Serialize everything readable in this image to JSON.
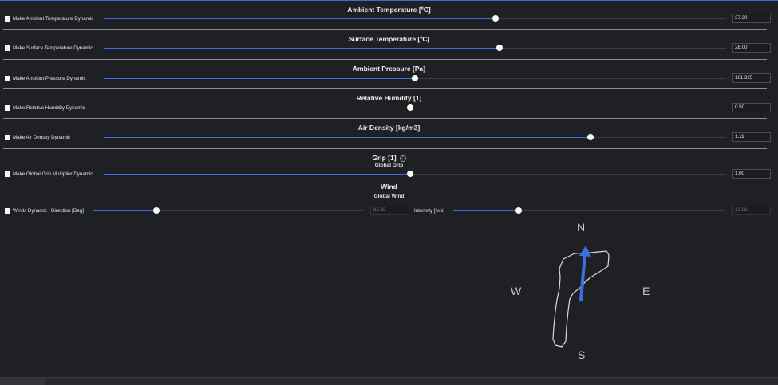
{
  "sections": {
    "ambient_temp": {
      "title": "Ambient Temperature [ºC]",
      "checkbox_label": "Make Ambient Temperature Dynamic",
      "value": "27.20",
      "slider_fraction": 0.63
    },
    "surface_temp": {
      "title": "Surface Temperature [ºC]",
      "checkbox_label": "Make Surface Temperature Dynamic",
      "value": "28.00",
      "slider_fraction": 0.636
    },
    "ambient_pressure": {
      "title": "Ambient Pressure [Pa]",
      "checkbox_label": "Make Ambient Pressure Dynamic",
      "value": "101,325",
      "slider_fraction": 0.5
    },
    "humidity": {
      "title": "Relative Humdity [1]",
      "checkbox_label": "Make Relative Humidity Dynamic",
      "value": "0.50",
      "slider_fraction": 0.492
    },
    "air_density": {
      "title": "Air Density [kg/m3]",
      "checkbox_label": "Make Air Density Dynamic",
      "value": "1.11",
      "slider_fraction": 0.782
    },
    "grip": {
      "title": "Grip [1]",
      "subtitle": "Global Grip",
      "checkbox_label": "Make Global Grip Multiplier Dynamic",
      "value": "1.00",
      "slider_fraction": 0.492
    }
  },
  "wind": {
    "title": "Wind",
    "subtitle": "Global Wind",
    "checkbox_label": "Winds Dynamic",
    "direction_label": "Direction [Deg]",
    "direction_value": "85.15",
    "direction_fraction": 0.236,
    "intensity_label": "Intensity [m/s]",
    "intensity_value": "13.96",
    "intensity_fraction": 0.24
  },
  "compass": {
    "north": "N",
    "south": "S",
    "east": "E",
    "west": "W"
  },
  "bottom_tab": {
    "label": ""
  },
  "colors": {
    "accent": "#3f6ee3",
    "background": "#1f2023",
    "text": "#e6e6e6",
    "divider": "#8b8d90"
  },
  "icons": {
    "info": "info-icon",
    "wind_arrow": "arrow-up-icon",
    "track": "track-outline"
  }
}
